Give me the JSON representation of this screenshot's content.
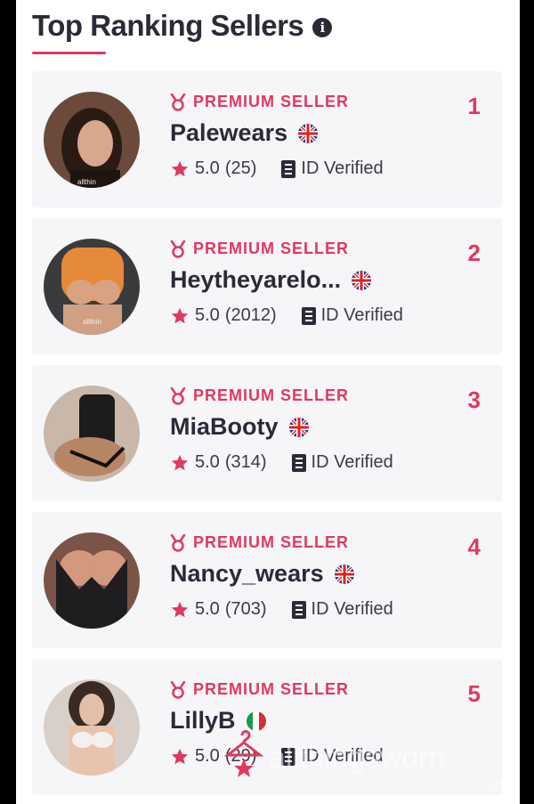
{
  "header": {
    "title": "Top Ranking Sellers",
    "info_icon": "info-icon"
  },
  "colors": {
    "accent": "#e1385e",
    "text": "#2b2b38",
    "card_bg": "#f6f6f9"
  },
  "sellers": [
    {
      "badge": "PREMIUM SELLER",
      "rank": "1",
      "name": "Palewears",
      "country_flag": "uk-flag-icon",
      "rating": "5.0",
      "reviews": "(25)",
      "verified": "ID Verified",
      "avatar_text": "allthin"
    },
    {
      "badge": "PREMIUM SELLER",
      "rank": "2",
      "name": "Heytheyarelo...",
      "country_flag": "uk-flag-icon",
      "rating": "5.0",
      "reviews": "(2012)",
      "verified": "ID Verified",
      "avatar_text": "allthin"
    },
    {
      "badge": "PREMIUM SELLER",
      "rank": "3",
      "name": "MiaBooty",
      "country_flag": "uk-flag-icon",
      "rating": "5.0",
      "reviews": "(314)",
      "verified": "ID Verified"
    },
    {
      "badge": "PREMIUM SELLER",
      "rank": "4",
      "name": "Nancy_wears",
      "country_flag": "uk-flag-icon",
      "rating": "5.0",
      "reviews": "(703)",
      "verified": "ID Verified"
    },
    {
      "badge": "PREMIUM SELLER",
      "rank": "5",
      "name": "LillyB",
      "country_flag": "italy-flag-icon",
      "rating": "5.0",
      "reviews": "(29)",
      "verified": "ID Verified"
    }
  ],
  "watermark": {
    "text": "allthingsworn",
    "suffix": ".com"
  }
}
